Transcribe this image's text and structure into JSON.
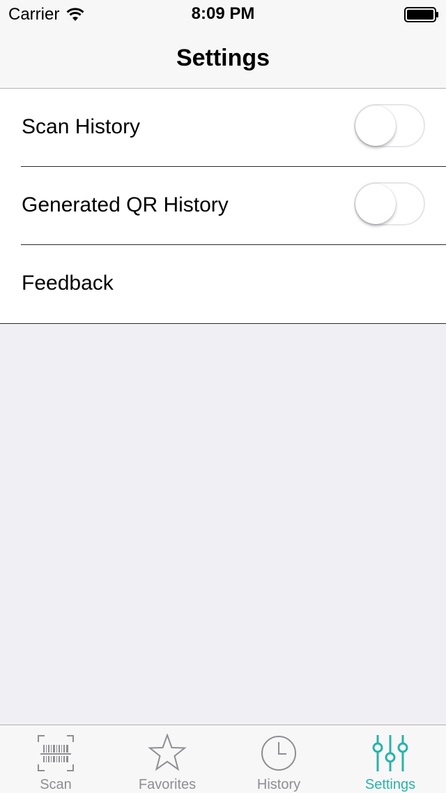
{
  "status_bar": {
    "carrier": "Carrier",
    "time": "8:09 PM"
  },
  "nav": {
    "title": "Settings"
  },
  "settings": {
    "rows": [
      {
        "label": "Scan History",
        "toggle": false
      },
      {
        "label": "Generated QR History",
        "toggle": false
      },
      {
        "label": "Feedback"
      }
    ]
  },
  "tab_bar": {
    "active_color": "#29b3a9",
    "inactive_color": "#8e8e93",
    "tabs": [
      {
        "label": "Scan",
        "icon": "barcode-scan-icon",
        "active": false
      },
      {
        "label": "Favorites",
        "icon": "star-icon",
        "active": false
      },
      {
        "label": "History",
        "icon": "clock-icon",
        "active": false
      },
      {
        "label": "Settings",
        "icon": "sliders-icon",
        "active": true
      }
    ]
  }
}
